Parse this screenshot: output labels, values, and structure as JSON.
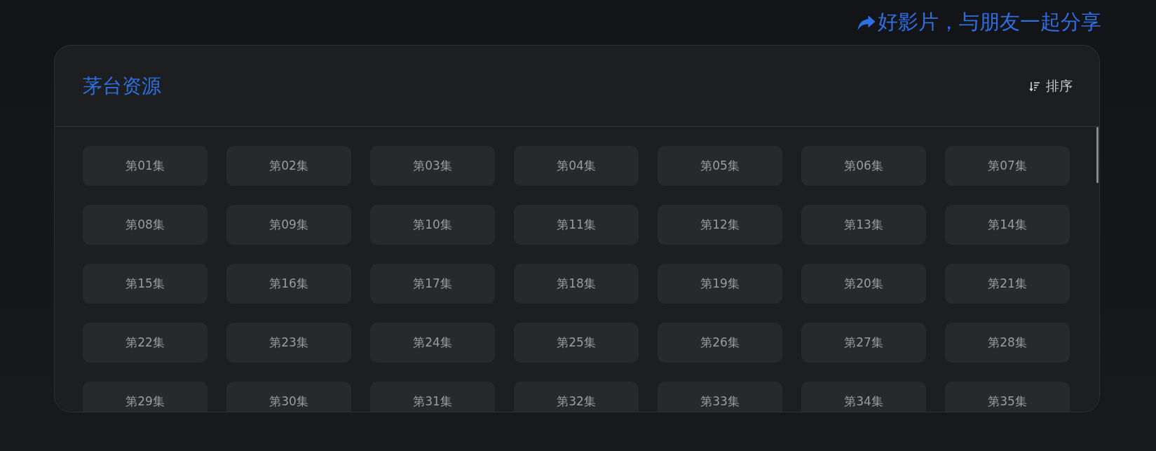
{
  "share": {
    "label": "好影片，与朋友一起分享"
  },
  "panel": {
    "title": "茅台资源",
    "sort": {
      "label": "排序"
    },
    "episodes": [
      {
        "label": "第01集",
        "selected": false
      },
      {
        "label": "第02集",
        "selected": false
      },
      {
        "label": "第03集",
        "selected": false
      },
      {
        "label": "第04集",
        "selected": false
      },
      {
        "label": "第05集",
        "selected": false
      },
      {
        "label": "第06集",
        "selected": false
      },
      {
        "label": "第07集",
        "selected": false
      },
      {
        "label": "第08集",
        "selected": false
      },
      {
        "label": "第09集",
        "selected": false
      },
      {
        "label": "第10集",
        "selected": false
      },
      {
        "label": "第11集",
        "selected": false
      },
      {
        "label": "第12集",
        "selected": false
      },
      {
        "label": "第13集",
        "selected": false
      },
      {
        "label": "第14集",
        "selected": false
      },
      {
        "label": "第15集",
        "selected": false
      },
      {
        "label": "第16集",
        "selected": false
      },
      {
        "label": "第17集",
        "selected": false
      },
      {
        "label": "第18集",
        "selected": false
      },
      {
        "label": "第19集",
        "selected": false
      },
      {
        "label": "第20集",
        "selected": false
      },
      {
        "label": "第21集",
        "selected": false
      },
      {
        "label": "第22集",
        "selected": false
      },
      {
        "label": "第23集",
        "selected": false
      },
      {
        "label": "第24集",
        "selected": false
      },
      {
        "label": "第25集",
        "selected": false
      },
      {
        "label": "第26集",
        "selected": false
      },
      {
        "label": "第27集",
        "selected": false
      },
      {
        "label": "第28集",
        "selected": false
      },
      {
        "label": "第29集",
        "selected": false
      },
      {
        "label": "第30集",
        "selected": false
      },
      {
        "label": "第31集",
        "selected": false
      },
      {
        "label": "第32集",
        "selected": false
      },
      {
        "label": "第33集",
        "selected": false
      },
      {
        "label": "第34集",
        "selected": false
      },
      {
        "label": "第35集",
        "selected": false
      }
    ]
  }
}
